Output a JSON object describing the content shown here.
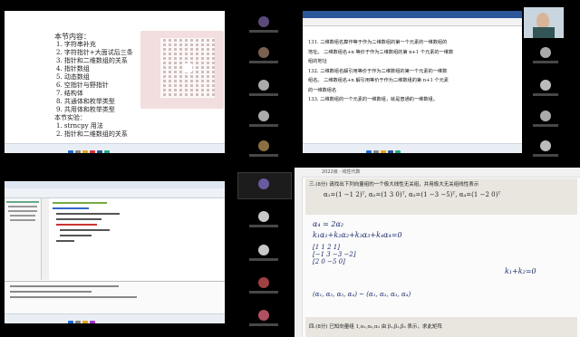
{
  "panel_top_left": {
    "heading_content": "本节内容：",
    "items": [
      "1. 字符串补充",
      "2. 字符指针+大面试后三条",
      "3. 指针和二维数组的关系",
      "4. 指针数组",
      "5. 动态数组",
      "6. 空指针与野指针",
      "7. 结构体",
      "8. 共通体和枚举类型",
      "9. 共用体和枚举类型"
    ],
    "heading_exp": "本节实验：",
    "exp_items": [
      "1. strncpy 用法",
      "2. 指针和二维数组的关系"
    ]
  },
  "panel_top_right": {
    "lines": [
      "131.   二维数组名算作等于作为二维数组的第一个元素的一维数组的",
      "地址。  二维数组名+n 等价于作为二维数组的第 n+1 个元素的一维数",
      "组的地址",
      "132.   二维数组名解引用等价于作为二维数组的第一个元素的一维数",
      "组名。  二维数组名+n 解引用等价于作为二维数组的第 n+1 个元素",
      "的一维数组名",
      "133.   二维数组的一个元素的一维数组，就是普通的一维数组。"
    ]
  },
  "panel_bottom_right": {
    "toolbar_title": "2022级 · 线性代数",
    "problem_top": "三.(8分)  请找出下列向量组的一个极大线性无关组，并用极大无关组线性表示",
    "line_eq1": "α₄ = 2α₂",
    "line_eq2": "k₁α₁+k₂α₂+k₃α₃+k₄α₄=0",
    "tail_text": "k₁+k₂=0",
    "bottom_line": "(α₁, α₂, α₃, α₄)  ~  (α₁, α₂, α₃, α₄)",
    "problem_bottom": "四.(8分)  已知向量组 1,α₁,α₂,α₃ 由 β₁,β₂,β₃ 表示，求此矩阵"
  }
}
